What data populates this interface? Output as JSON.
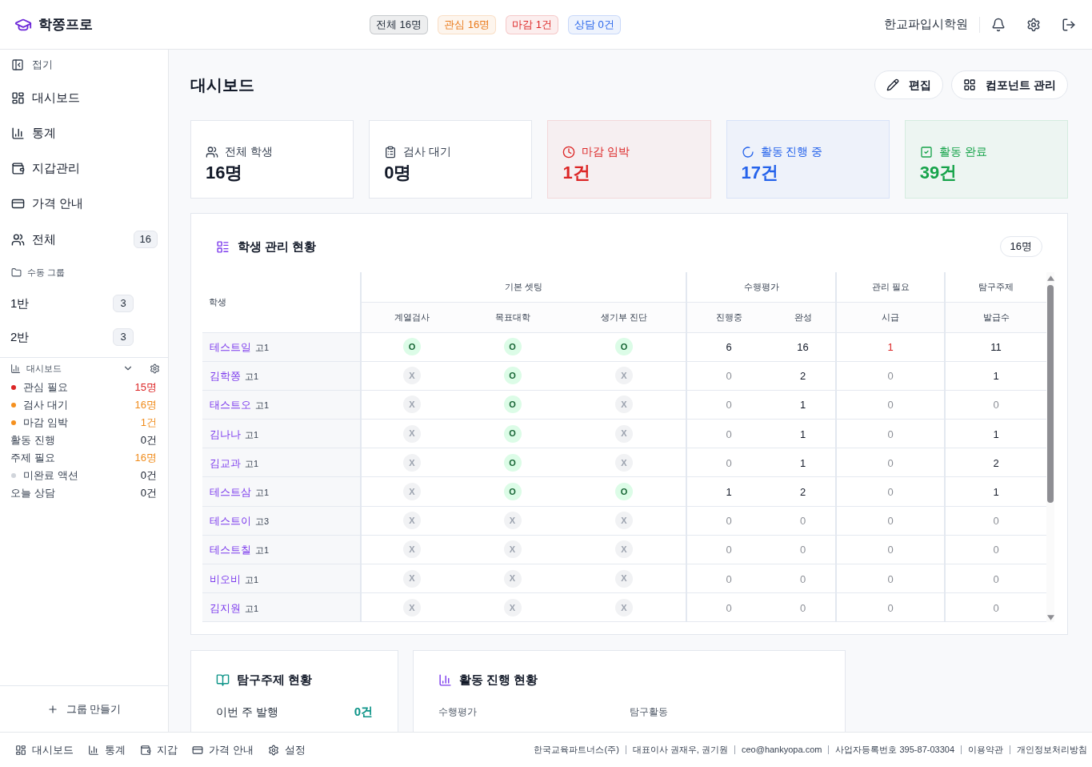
{
  "top_bar": {
    "logo": "학쫑프로",
    "badges": [
      {
        "label": "전체 16명",
        "color": "#1f2937"
      },
      {
        "label": "관심 16명",
        "color": "#ea7a1a"
      },
      {
        "label": "마감 1건",
        "color": "#dc2626"
      },
      {
        "label": "상담 0건",
        "color": "#2563eb"
      }
    ],
    "academy": "한교파입시학원"
  },
  "sidebar": {
    "collapse": "접기",
    "nav": [
      "대시보드",
      "통계",
      "지갑관리",
      "가격 안내"
    ],
    "all": {
      "label": "전체",
      "count": "16"
    },
    "group_title": "수동 그룹",
    "groups": [
      {
        "label": "1반",
        "count": "3"
      },
      {
        "label": "2반",
        "count": "3"
      }
    ],
    "widget": {
      "title": "대시보드",
      "rows": [
        {
          "label": "관심 필요",
          "value": "15명",
          "color": "#dc2626",
          "dot": {
            "color": "#dc2626"
          }
        },
        {
          "label": "검사 대기",
          "value": "16명",
          "color": "#f08c1c",
          "dot": {
            "color": "#f5901e"
          }
        },
        {
          "label": "마감 임박",
          "value": "1건",
          "color": "#f08c1c",
          "dot": {
            "color": "#f5901e"
          }
        },
        {
          "label": "활동 진행",
          "value": "0건"
        },
        {
          "label": "주제 필요",
          "value": "16명",
          "color": "#f08c1c"
        },
        {
          "label": "미완료 액션",
          "value": "0건",
          "dot": {
            "color": "#d1d5db"
          }
        },
        {
          "label": "오늘 상담",
          "value": "0건"
        }
      ]
    },
    "create_group": "그룹 만들기"
  },
  "main": {
    "title": "대시보드",
    "actions": [
      "편집",
      "컴포넌트 관리"
    ],
    "stats": [
      {
        "label": "전체 학생",
        "value": "16명"
      },
      {
        "label": "검사 대기",
        "value": "0명"
      },
      {
        "label": "마감 임박",
        "value": "1건",
        "color": "#dc2626"
      },
      {
        "label": "활동 진행 중",
        "value": "17건",
        "color": "#2563eb"
      },
      {
        "label": "활동 완료",
        "value": "39건",
        "color": "#16a34a"
      }
    ],
    "student_table": {
      "title": "학생 관리 현황",
      "count": "16명",
      "first_column": "학생",
      "groups": [
        {
          "label": "기본 셋팅",
          "columns": [
            "계열검사",
            "목표대학",
            "생기부 진단"
          ]
        },
        {
          "label": "수행평가",
          "columns": [
            "진행중",
            "완성"
          ]
        },
        {
          "label": "관리 필요",
          "columns": [
            "시급"
          ]
        },
        {
          "label": "탐구주제",
          "columns": [
            "발급수"
          ]
        }
      ],
      "rows": [
        {
          "name": "테스트일",
          "grade": "고1",
          "checks": [
            {
              "text": "O",
              "done": true
            },
            {
              "text": "O",
              "done": true
            },
            {
              "text": "O",
              "done": true
            }
          ],
          "counts": [
            {
              "text": "6",
              "dim": false,
              "alert": false
            },
            {
              "text": "16",
              "dim": false,
              "alert": false
            },
            {
              "text": "1",
              "dim": false,
              "alert": true
            },
            {
              "text": "11",
              "dim": false,
              "alert": false
            }
          ]
        },
        {
          "name": "김학쫑",
          "grade": "고1",
          "checks": [
            {
              "text": "X",
              "done": false
            },
            {
              "text": "O",
              "done": true
            },
            {
              "text": "X",
              "done": false
            }
          ],
          "counts": [
            {
              "text": "0",
              "dim": true,
              "alert": false
            },
            {
              "text": "2",
              "dim": false,
              "alert": false
            },
            {
              "text": "0",
              "dim": true,
              "alert": false
            },
            {
              "text": "1",
              "dim": false,
              "alert": false
            }
          ]
        },
        {
          "name": "태스트오",
          "grade": "고1",
          "checks": [
            {
              "text": "X",
              "done": false
            },
            {
              "text": "O",
              "done": true
            },
            {
              "text": "X",
              "done": false
            }
          ],
          "counts": [
            {
              "text": "0",
              "dim": true,
              "alert": false
            },
            {
              "text": "1",
              "dim": false,
              "alert": false
            },
            {
              "text": "0",
              "dim": true,
              "alert": false
            },
            {
              "text": "0",
              "dim": true,
              "alert": false
            }
          ]
        },
        {
          "name": "김나나",
          "grade": "고1",
          "checks": [
            {
              "text": "X",
              "done": false
            },
            {
              "text": "O",
              "done": true
            },
            {
              "text": "X",
              "done": false
            }
          ],
          "counts": [
            {
              "text": "0",
              "dim": true,
              "alert": false
            },
            {
              "text": "1",
              "dim": false,
              "alert": false
            },
            {
              "text": "0",
              "dim": true,
              "alert": false
            },
            {
              "text": "1",
              "dim": false,
              "alert": false
            }
          ]
        },
        {
          "name": "김교과",
          "grade": "고1",
          "checks": [
            {
              "text": "X",
              "done": false
            },
            {
              "text": "O",
              "done": true
            },
            {
              "text": "X",
              "done": false
            }
          ],
          "counts": [
            {
              "text": "0",
              "dim": true,
              "alert": false
            },
            {
              "text": "1",
              "dim": false,
              "alert": false
            },
            {
              "text": "0",
              "dim": true,
              "alert": false
            },
            {
              "text": "2",
              "dim": false,
              "alert": false
            }
          ]
        },
        {
          "name": "테스트삼",
          "grade": "고1",
          "checks": [
            {
              "text": "X",
              "done": false
            },
            {
              "text": "O",
              "done": true
            },
            {
              "text": "O",
              "done": true
            }
          ],
          "counts": [
            {
              "text": "1",
              "dim": false,
              "alert": false
            },
            {
              "text": "2",
              "dim": false,
              "alert": false
            },
            {
              "text": "0",
              "dim": true,
              "alert": false
            },
            {
              "text": "1",
              "dim": false,
              "alert": false
            }
          ]
        },
        {
          "name": "테스트이",
          "grade": "고3",
          "checks": [
            {
              "text": "X",
              "done": false
            },
            {
              "text": "X",
              "done": false
            },
            {
              "text": "X",
              "done": false
            }
          ],
          "counts": [
            {
              "text": "0",
              "dim": true,
              "alert": false
            },
            {
              "text": "0",
              "dim": true,
              "alert": false
            },
            {
              "text": "0",
              "dim": true,
              "alert": false
            },
            {
              "text": "0",
              "dim": true,
              "alert": false
            }
          ]
        },
        {
          "name": "테스트칠",
          "grade": "고1",
          "checks": [
            {
              "text": "X",
              "done": false
            },
            {
              "text": "X",
              "done": false
            },
            {
              "text": "X",
              "done": false
            }
          ],
          "counts": [
            {
              "text": "0",
              "dim": true,
              "alert": false
            },
            {
              "text": "0",
              "dim": true,
              "alert": false
            },
            {
              "text": "0",
              "dim": true,
              "alert": false
            },
            {
              "text": "0",
              "dim": true,
              "alert": false
            }
          ]
        },
        {
          "name": "비오비",
          "grade": "고1",
          "checks": [
            {
              "text": "X",
              "done": false
            },
            {
              "text": "X",
              "done": false
            },
            {
              "text": "X",
              "done": false
            }
          ],
          "counts": [
            {
              "text": "0",
              "dim": true,
              "alert": false
            },
            {
              "text": "0",
              "dim": true,
              "alert": false
            },
            {
              "text": "0",
              "dim": true,
              "alert": false
            },
            {
              "text": "0",
              "dim": true,
              "alert": false
            }
          ]
        },
        {
          "name": "김지원",
          "grade": "고1",
          "checks": [
            {
              "text": "X",
              "done": false
            },
            {
              "text": "X",
              "done": false
            },
            {
              "text": "X",
              "done": false
            }
          ],
          "counts": [
            {
              "text": "0",
              "dim": true,
              "alert": false
            },
            {
              "text": "0",
              "dim": true,
              "alert": false
            },
            {
              "text": "0",
              "dim": true,
              "alert": false
            },
            {
              "text": "0",
              "dim": true,
              "alert": false
            }
          ]
        }
      ]
    },
    "topic_card": {
      "title": "탐구주제 현황",
      "rows": [
        {
          "label": "이번 주 발행",
          "value": "0건"
        }
      ]
    },
    "activity_card": {
      "title": "활동 진행 현황",
      "columns": [
        "수행평가",
        "탐구활동"
      ]
    }
  },
  "footer": {
    "nav": [
      "대시보드",
      "통계",
      "지갑",
      "가격 안내",
      "설정"
    ],
    "info": [
      "한국교육파트너스(주)",
      "대표이사 권재우, 권기원",
      "ceo@hankyopa.com",
      "사업자등록번호 395-87-03304",
      "이용약관",
      "개인정보처리방침"
    ]
  }
}
